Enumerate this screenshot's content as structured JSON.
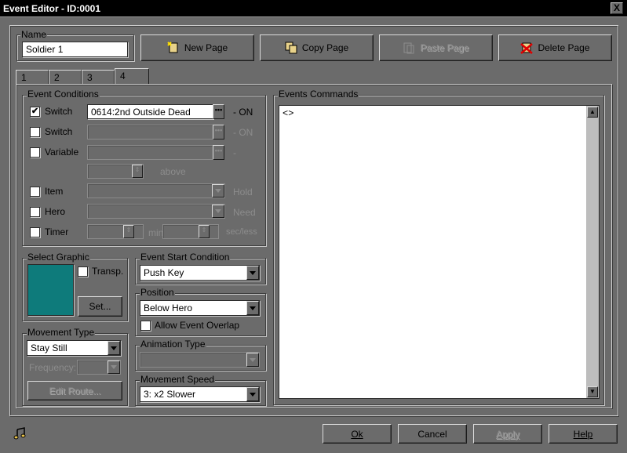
{
  "window": {
    "title": "Event Editor - ID:0001",
    "close_label": "X"
  },
  "name": {
    "label": "Name",
    "value": "Soldier 1"
  },
  "page_buttons": {
    "new": "New Page",
    "copy": "Copy Page",
    "paste": "Paste Page",
    "delete": "Delete Page"
  },
  "tabs": [
    {
      "label": "1"
    },
    {
      "label": "2"
    },
    {
      "label": "3"
    },
    {
      "label": "4"
    }
  ],
  "active_tab": "4",
  "conditions": {
    "label": "Event Conditions",
    "switch1": {
      "label": "Switch",
      "value": "0614:2nd Outside Dead",
      "suffix": "- ON",
      "checked": "✔"
    },
    "switch2": {
      "label": "Switch",
      "suffix": "- ON"
    },
    "variable": {
      "label": "Variable",
      "suffix": "-",
      "above": "above"
    },
    "item": {
      "label": "Item",
      "suffix": "Hold"
    },
    "hero": {
      "label": "Hero",
      "suffix": "Need"
    },
    "timer": {
      "label": "Timer",
      "min": "min",
      "sec": "sec/less"
    }
  },
  "graphic": {
    "label": "Select Graphic",
    "transp": "Transp.",
    "set": "Set...",
    "swatch_color": "#0e7b7b"
  },
  "start_condition": {
    "label": "Event Start Condition",
    "value": "Push Key"
  },
  "position": {
    "label": "Position",
    "value": "Below Hero",
    "overlap": "Allow Event Overlap"
  },
  "movement_type": {
    "label": "Movement Type",
    "value": "Stay Still",
    "frequency": "Frequency:",
    "edit_route": "Edit Route..."
  },
  "animation_type": {
    "label": "Animation Type"
  },
  "movement_speed": {
    "label": "Movement Speed",
    "value": "3: x2 Slower"
  },
  "commands": {
    "label": "Events Commands",
    "lines": [
      "<>"
    ]
  },
  "footer": {
    "ok": "Ok",
    "cancel": "Cancel",
    "apply": "Apply",
    "help": "Help"
  },
  "icons": {
    "music": "music-note-icon"
  }
}
